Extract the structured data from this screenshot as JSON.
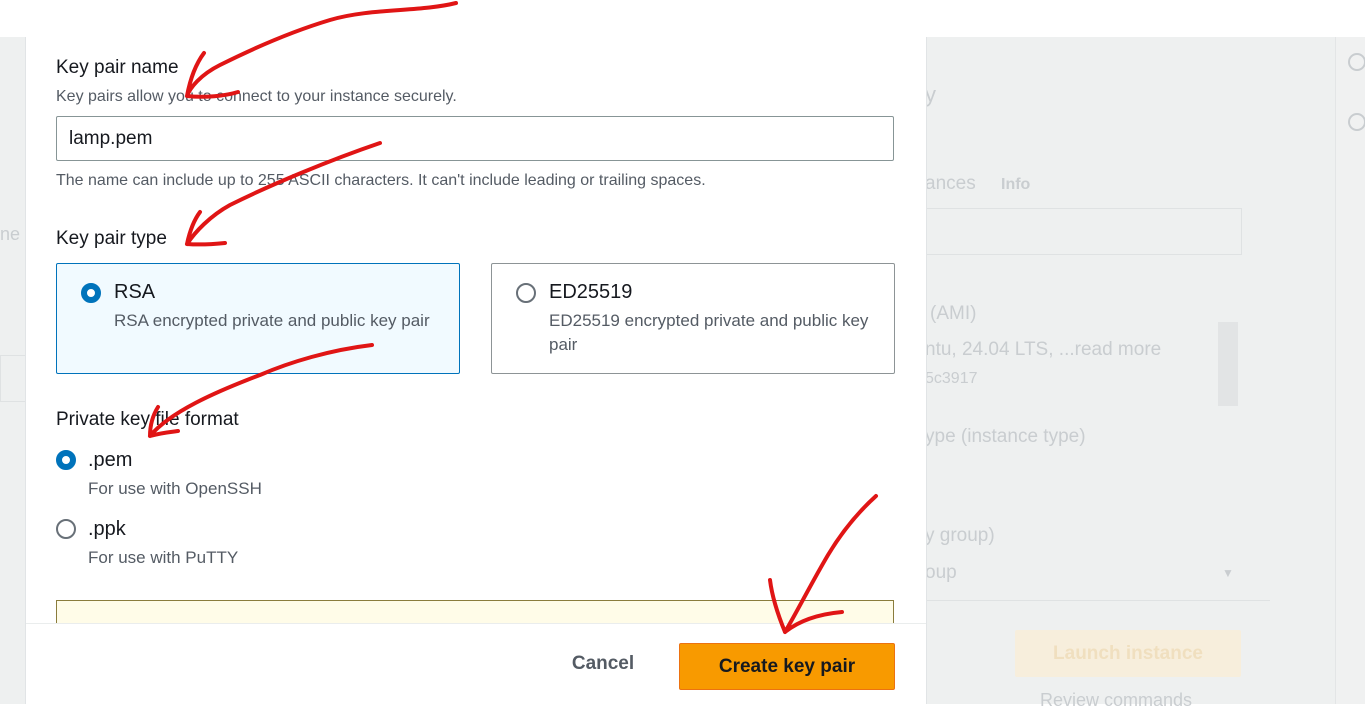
{
  "modal": {
    "key_pair_name": {
      "label": "Key pair name",
      "description": "Key pairs allow you to connect to your instance securely.",
      "value": "lamp.pem",
      "constraint": "The name can include up to 255 ASCII characters. It can't include leading or trailing spaces."
    },
    "key_pair_type": {
      "label": "Key pair type",
      "options": [
        {
          "title": "RSA",
          "description": "RSA encrypted private and public key pair",
          "selected": true
        },
        {
          "title": "ED25519",
          "description": "ED25519 encrypted private and public key pair",
          "selected": false
        }
      ]
    },
    "file_format": {
      "label": "Private key file format",
      "options": [
        {
          "title": ".pem",
          "description": "For use with OpenSSH",
          "selected": true
        },
        {
          "title": ".ppk",
          "description": "For use with PuTTY",
          "selected": false
        }
      ]
    },
    "footer": {
      "cancel_label": "Cancel",
      "create_label": "Create key pair"
    }
  },
  "background": {
    "instances_fragment": "ances",
    "info_link": "Info",
    "ami_fragment": "(AMI)",
    "ubuntu_fragment": "ntu, 24.04 LTS, ...read more",
    "ami_id_fragment": "5c3917",
    "type_fragment": "ype (instance type)",
    "group_fragment": "y group)",
    "group2_fragment": "oup",
    "left_fragment": "ne",
    "launch_label": "Launch instance",
    "review_fragment": "Review commands"
  },
  "colors": {
    "accent": "#0073bb",
    "primary_button": "#f89a00",
    "annotation": "#e01515"
  }
}
